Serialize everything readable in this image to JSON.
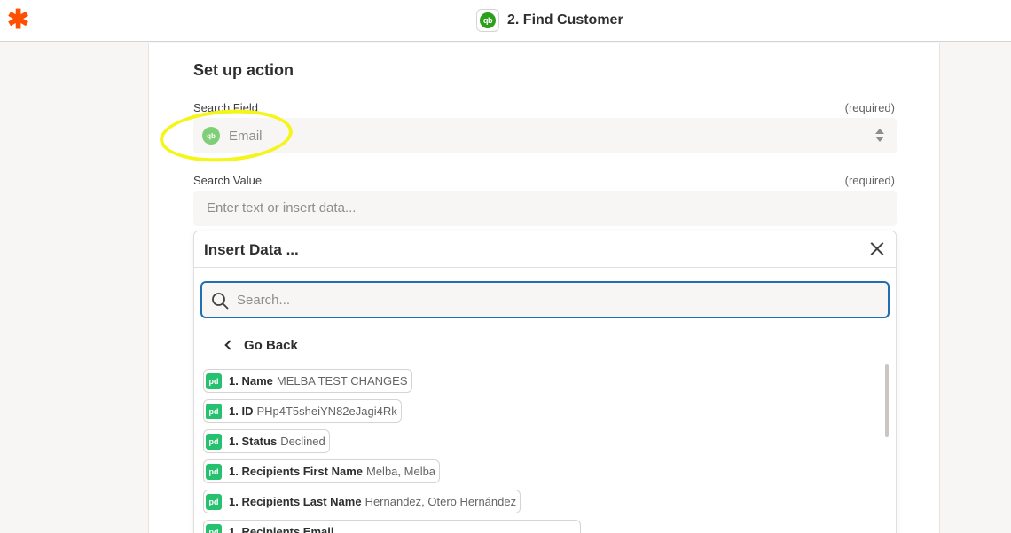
{
  "header": {
    "logo_glyph": "✱",
    "app_icon_text": "qb",
    "title": "2. Find Customer"
  },
  "section": {
    "title": "Set up action"
  },
  "search_field": {
    "label": "Search Field",
    "required": "(required)",
    "value": "Email",
    "icon_text": "qb"
  },
  "search_value": {
    "label": "Search Value",
    "required": "(required)",
    "placeholder": "Enter text or insert data..."
  },
  "insert_data": {
    "title": "Insert Data ...",
    "search_placeholder": "Search...",
    "go_back": "Go Back",
    "items": [
      {
        "key": "1. Name",
        "value": "MELBA TEST CHANGES"
      },
      {
        "key": "1. ID",
        "value": "PHp4T5sheiYN82eJagi4Rk"
      },
      {
        "key": "1. Status",
        "value": "Declined"
      },
      {
        "key": "1. Recipients First Name",
        "value": "Melba, Melba"
      },
      {
        "key": "1. Recipients Last Name",
        "value": "Hernandez, Otero Hernández"
      },
      {
        "key": "1. Recipients Email",
        "value": ""
      }
    ]
  },
  "colors": {
    "brand": "#ff4f00",
    "quickbooks": "#2ca01c",
    "pandadoc": "#25c16f",
    "focus": "#1f6fb2",
    "highlight": "#f5f51a"
  }
}
